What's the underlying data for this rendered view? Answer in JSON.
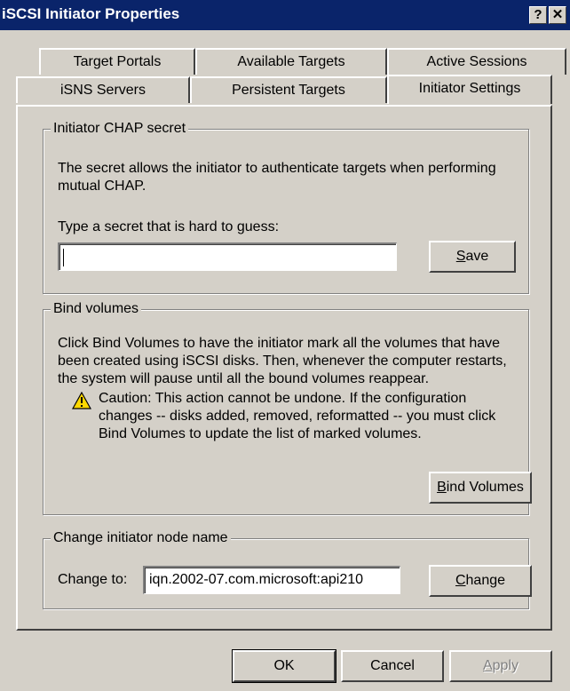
{
  "window": {
    "title": "iSCSI Initiator Properties",
    "help_label": "?",
    "close_label": "✕"
  },
  "tabs": {
    "row_back": [
      "Target Portals",
      "Available Targets",
      "Active Sessions"
    ],
    "row_front": [
      "iSNS Servers",
      "Persistent Targets",
      "Initiator Settings"
    ],
    "active": "Initiator Settings"
  },
  "chap": {
    "group_label": "Initiator CHAP secret",
    "description": "The secret allows the initiator to authenticate targets when performing mutual CHAP.",
    "prompt": "Type a secret that is hard to guess:",
    "secret_value": "",
    "save_label_hotkey": "S",
    "save_label_rest": "ave"
  },
  "bind": {
    "group_label": "Bind volumes",
    "description": "Click Bind Volumes to have the initiator mark all the volumes that have been created using iSCSI disks. Then, whenever the computer restarts, the system will pause until all the bound volumes reappear.",
    "caution": "Caution: This action cannot be undone. If the configuration changes -- disks added, removed, reformatted -- you must click Bind Volumes to update the list of marked volumes.",
    "warning_icon": "warning-icon",
    "button_hotkey": "B",
    "button_rest": "ind Volumes"
  },
  "node": {
    "group_label": "Change initiator node name",
    "change_to_label": "Change to:",
    "node_name": "iqn.2002-07.com.microsoft:api210",
    "change_hotkey": "C",
    "change_rest": "hange"
  },
  "footer": {
    "ok_label": "OK",
    "cancel_label": "Cancel",
    "apply_hotkey": "A",
    "apply_rest": "pply"
  },
  "colors": {
    "titlebar": "#0a246a",
    "face": "#d4d0c8",
    "warning_yellow": "#ffd800"
  }
}
